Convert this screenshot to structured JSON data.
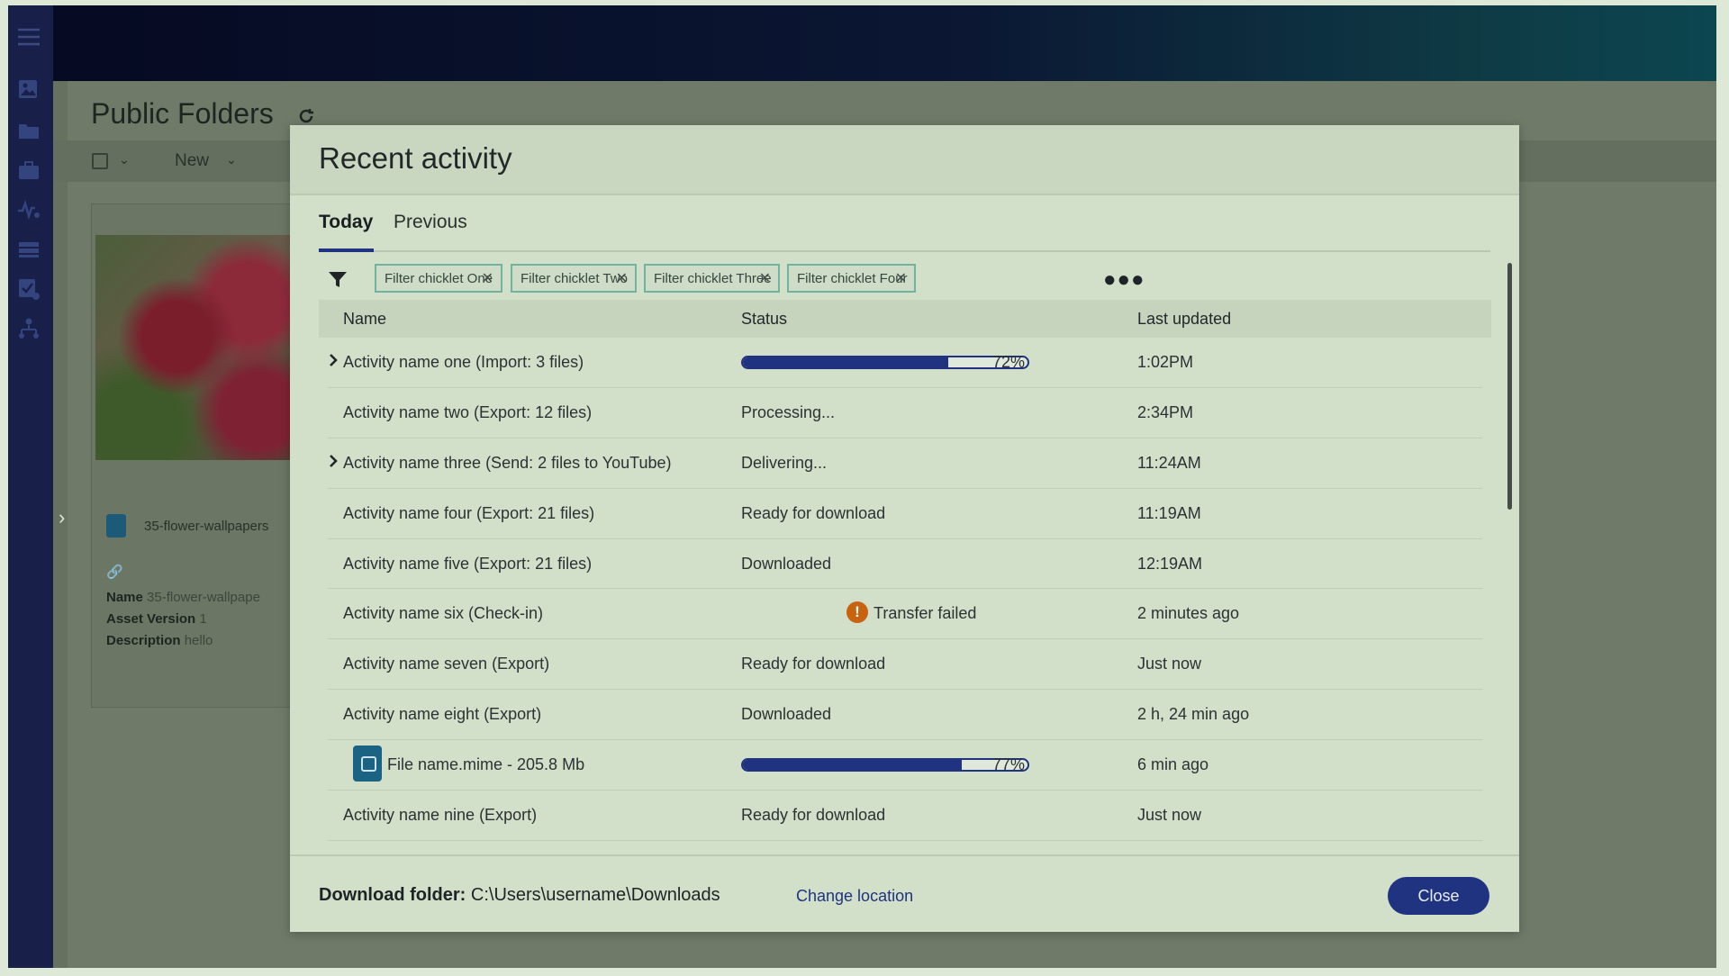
{
  "background_page": {
    "title": "Public Folders",
    "toolbar": {
      "new_label": "New"
    },
    "asset": {
      "file_name": "35-flower-wallpapers",
      "name_label": "Name",
      "name_value": "35-flower-wallpape",
      "version_label": "Asset Version",
      "version_value": "1",
      "description_label": "Description",
      "description_value": "hello"
    }
  },
  "modal": {
    "title": "Recent activity",
    "tabs": [
      {
        "label": "Today",
        "active": true
      },
      {
        "label": "Previous",
        "active": false
      }
    ],
    "filters": [
      "Filter chicklet One",
      "Filter chicklet Two",
      "Filter chicklet Three",
      "Filter chicklet Four"
    ],
    "columns": {
      "name": "Name",
      "status": "Status",
      "updated": "Last updated"
    },
    "rows": [
      {
        "name": "Activity name one (Import: 3 files)",
        "status_type": "progress",
        "progress": 72,
        "percent_label": "72%",
        "updated": "1:02PM",
        "expandable": true
      },
      {
        "name": "Activity name two (Export: 12 files)",
        "status_type": "text",
        "status": "Processing...",
        "updated": "2:34PM",
        "expandable": false
      },
      {
        "name": "Activity name three (Send: 2 files to YouTube)",
        "status_type": "text",
        "status": "Delivering...",
        "updated": "11:24AM",
        "expandable": true
      },
      {
        "name": "Activity name four (Export: 21 files)",
        "status_type": "text",
        "status": "Ready for download",
        "updated": "11:19AM",
        "expandable": false
      },
      {
        "name": "Activity name five (Export: 21 files)",
        "status_type": "text",
        "status": "Downloaded",
        "updated": "12:19AM",
        "expandable": false
      },
      {
        "name": "Activity name six (Check-in)",
        "status_type": "error",
        "status": "Transfer failed",
        "updated": "2 minutes ago",
        "expandable": false
      },
      {
        "name": "Activity name seven (Export)",
        "status_type": "text",
        "status": "Ready for download",
        "updated": "Just now",
        "expandable": false
      },
      {
        "name": "Activity name eight (Export)",
        "status_type": "text",
        "status": "Downloaded",
        "updated": "2 h, 24 min ago",
        "expandable": false
      },
      {
        "name": "File name.mime - 205.8 Mb",
        "status_type": "progress",
        "progress": 77,
        "percent_label": "77%",
        "updated": "6 min ago",
        "expandable": false,
        "file": true
      },
      {
        "name": "Activity name nine (Export)",
        "status_type": "text",
        "status": "Ready for download",
        "updated": "Just now",
        "expandable": false
      }
    ],
    "footer": {
      "download_label": "Download folder:",
      "download_path": "C:\\Users\\username\\Downloads",
      "change_location": "Change location",
      "close": "Close"
    }
  },
  "colors": {
    "accent": "#1f3380",
    "chip_border": "#6fb3a0",
    "warning": "#c9620f",
    "rail": "#18204a"
  }
}
